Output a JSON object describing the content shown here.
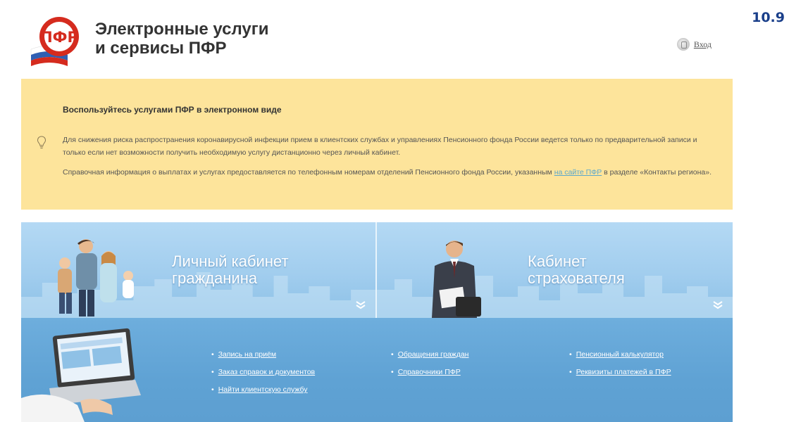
{
  "page_number": "10.9",
  "header": {
    "title_line1": "Электронные услуги",
    "title_line2": "и сервисы ПФР",
    "login_label": "Вход"
  },
  "notice": {
    "title": "Воспользуйтесь услугами ПФР в электронном виде",
    "paragraph1": "Для снижения риска распространения коронавирусной инфекции прием в клиентских службах и управлениях Пенсионного фонда России ведется только по предварительной записи и только если нет возможности получить необходимую услугу дистанционно через личный кабинет.",
    "paragraph2_before": "Справочная информация о выплатах и услугах предоставляется по телефонным номерам отделений Пенсионного фонда России, указанным ",
    "paragraph2_link": "на сайте ПФР",
    "paragraph2_after": " в разделе «Контакты региона»."
  },
  "cabinets": {
    "citizen_line1": "Личный кабинет",
    "citizen_line2": "гражданина",
    "insurer_line1": "Кабинет",
    "insurer_line2": "страхователя"
  },
  "services": {
    "col1": [
      "Запись на приём",
      "Заказ справок и документов",
      "Найти клиентскую службу"
    ],
    "col2": [
      "Обращения граждан",
      "Справочники ПФР"
    ],
    "col3": [
      "Пенсионный калькулятор",
      "Реквизиты платежей в ПФР"
    ],
    "bullet": "•"
  },
  "colors": {
    "notice_bg": "#fde49b",
    "banner_blue": "#a1cdee",
    "services_blue": "#5fa2d4",
    "link": "#5aa7cc",
    "logo_red": "#d52b1e",
    "page_number": "#1a3f8a"
  },
  "icons": [
    "pfr-logo-icon",
    "login-icon",
    "lightbulb-icon",
    "chevron-down-icon",
    "laptop-icon"
  ]
}
